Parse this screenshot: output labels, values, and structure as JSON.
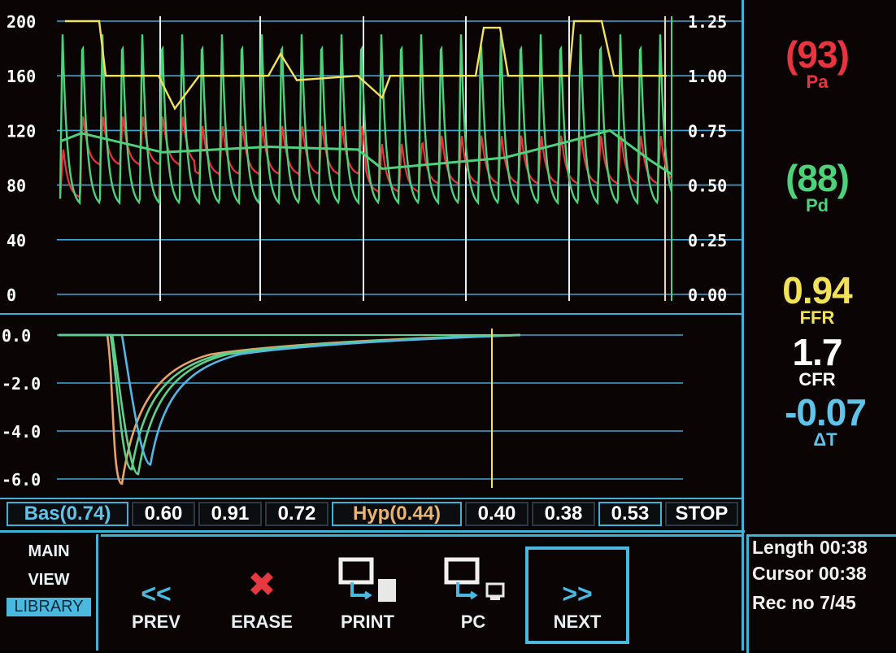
{
  "pressure_chart": {
    "left_ticks": [
      "200",
      "160",
      "120",
      "80",
      "40",
      "0"
    ],
    "right_ticks": [
      "1.25",
      "1.00",
      "0.75",
      "0.50",
      "0.25",
      "0.00"
    ],
    "colors": {
      "pa": "#e8343f",
      "pd": "#4fd07a",
      "ffr": "#f2e15a",
      "grid": "#3fa6d8",
      "marker": "#e9f1f6"
    }
  },
  "thermo_chart": {
    "y_ticks": [
      "0.0",
      "-2.0",
      "-4.0",
      "-6.0"
    ],
    "colors": {
      "curve_a": "#e8a26a",
      "curve_b": "#5fd08a",
      "curve_c": "#54b7e3",
      "cursor": "#f2e15a"
    }
  },
  "readouts": {
    "pa": {
      "value": "(93)",
      "label": "Pa",
      "color": "#e8343f"
    },
    "pd": {
      "value": "(88)",
      "label": "Pd",
      "color": "#4fd07a"
    },
    "ffr": {
      "value": "0.94",
      "label": "FFR",
      "color": "#f2e15a"
    },
    "cfr": {
      "value": "1.7",
      "label": "CFR",
      "color": "#ffffff"
    },
    "dt": {
      "value": "-0.07",
      "label": "ΔT",
      "color": "#5fc3ea"
    }
  },
  "strip": {
    "cells": [
      "Bas(0.74)",
      "0.60",
      "0.91",
      "0.72",
      "Hyp(0.44)",
      "0.40",
      "0.38",
      "0.53",
      "STOP"
    ],
    "bas_color": "#5fc3ea",
    "hyp_color": "#e9b46e"
  },
  "modes": {
    "main": "MAIN",
    "view": "VIEW",
    "library": "LIBRARY"
  },
  "toolbar": {
    "prev": "PREV",
    "erase": "ERASE",
    "print": "PRINT",
    "pc": "PC",
    "next": "NEXT",
    "prev_glyph": "<<",
    "next_glyph": ">>",
    "erase_glyph": "✖"
  },
  "info": {
    "length": "Length 00:38",
    "cursor": "Cursor 00:38",
    "rec": "Rec no 7/45"
  }
}
